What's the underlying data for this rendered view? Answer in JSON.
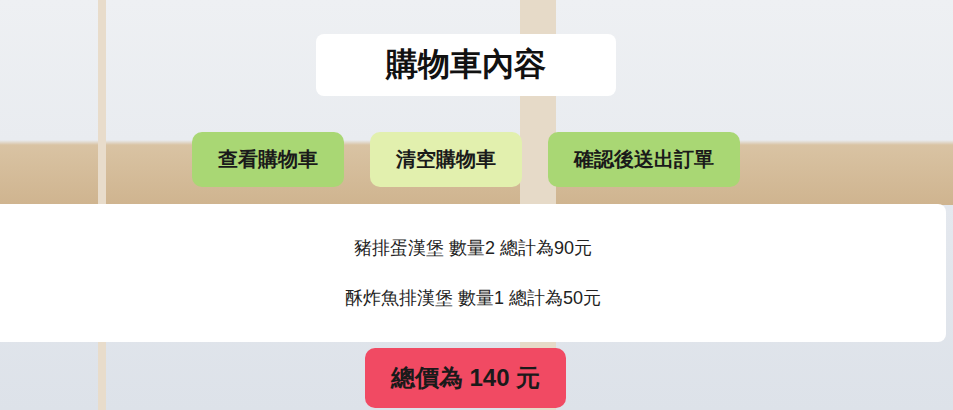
{
  "page": {
    "title": "購物車內容"
  },
  "buttons": [
    {
      "label": "查看購物車",
      "color": "#a9d774"
    },
    {
      "label": "清空購物車",
      "color": "#e2f0ae"
    },
    {
      "label": "確認後送出訂單",
      "color": "#a9d774"
    }
  ],
  "cart": {
    "items": [
      "豬排蛋漢堡 數量2 總計為90元",
      "酥炸魚排漢堡 數量1 總計為50元"
    ]
  },
  "total": "總價為 140 元"
}
